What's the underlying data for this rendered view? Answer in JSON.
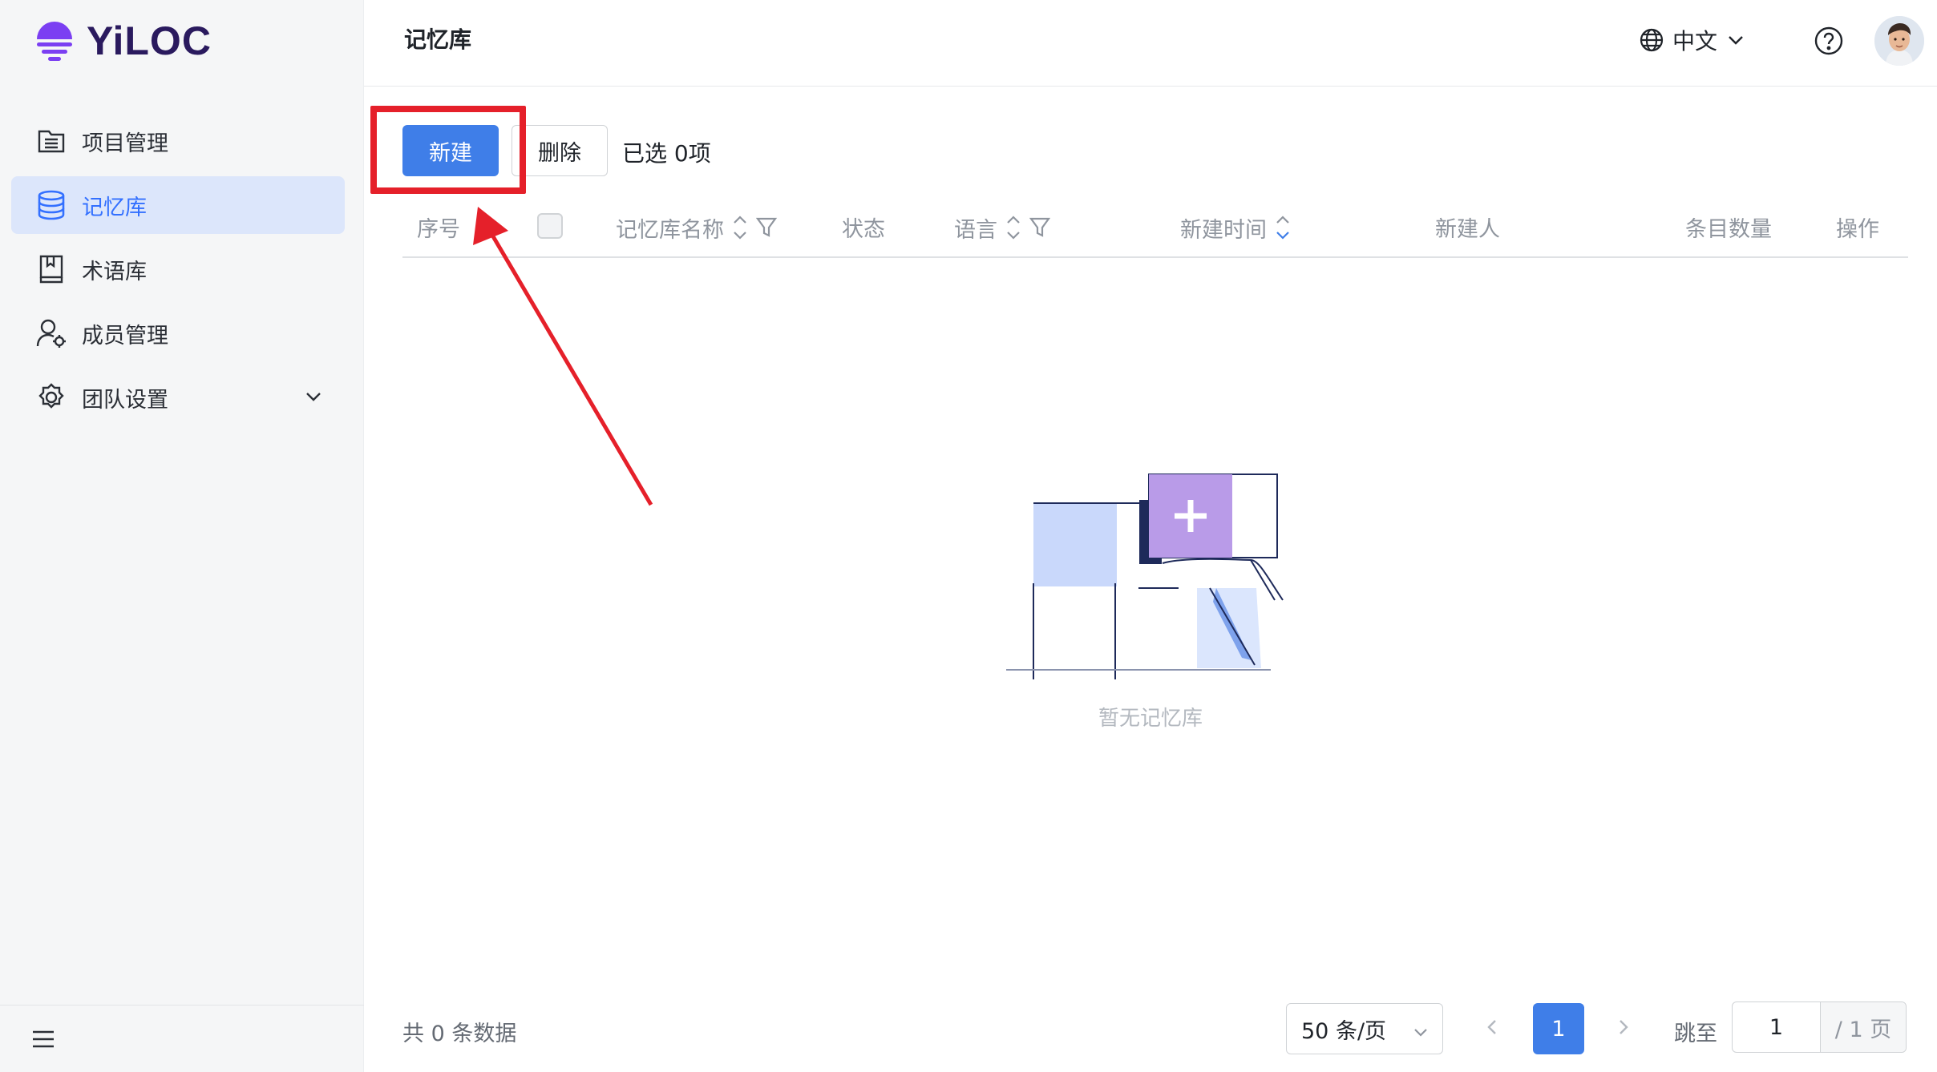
{
  "brand": {
    "name": "YiLOC"
  },
  "sidebar": {
    "items": [
      {
        "label": "项目管理",
        "icon": "list-icon"
      },
      {
        "label": "记忆库",
        "icon": "database-icon",
        "active": true
      },
      {
        "label": "术语库",
        "icon": "book-icon"
      },
      {
        "label": "成员管理",
        "icon": "user-settings-icon"
      },
      {
        "label": "团队设置",
        "icon": "gear-icon",
        "expandable": true
      }
    ]
  },
  "header": {
    "title": "记忆库",
    "language": "中文"
  },
  "toolbar": {
    "new_label": "新建",
    "delete_label": "删除",
    "selected_text": "已选 0项"
  },
  "table": {
    "columns": {
      "index": "序号",
      "name": "记忆库名称",
      "status": "状态",
      "language": "语言",
      "created_time": "新建时间",
      "creator": "新建人",
      "entries": "条目数量",
      "actions": "操作"
    },
    "empty_text": "暂无记忆库"
  },
  "footer": {
    "total_text": "共 0 条数据",
    "page_size": "50 条/页",
    "current_page": "1",
    "jump_label": "跳至",
    "jump_value": "1",
    "total_pages_text": "/ 1 页"
  },
  "colors": {
    "primary": "#3f7ee8",
    "active_bg": "#dce6fb",
    "annotation": "#e5202a"
  }
}
